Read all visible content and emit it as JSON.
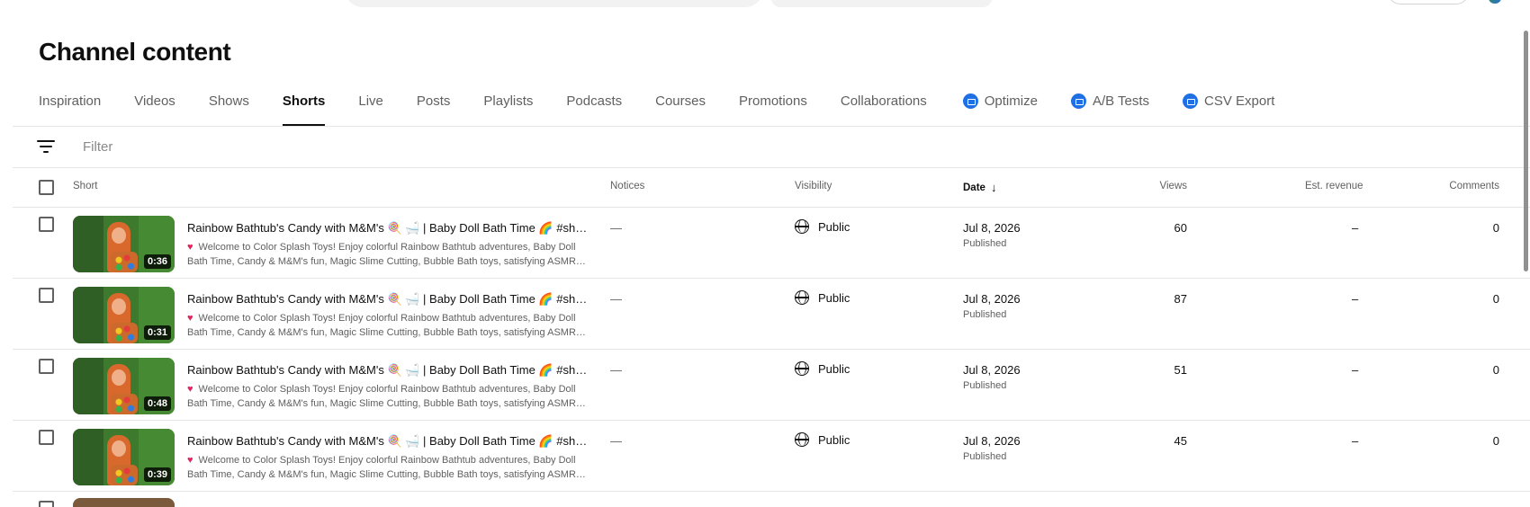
{
  "page": {
    "title": "Channel content"
  },
  "tabs": [
    {
      "label": "Inspiration",
      "active": false,
      "ext": false
    },
    {
      "label": "Videos",
      "active": false,
      "ext": false
    },
    {
      "label": "Shows",
      "active": false,
      "ext": false
    },
    {
      "label": "Shorts",
      "active": true,
      "ext": false
    },
    {
      "label": "Live",
      "active": false,
      "ext": false
    },
    {
      "label": "Posts",
      "active": false,
      "ext": false
    },
    {
      "label": "Playlists",
      "active": false,
      "ext": false
    },
    {
      "label": "Podcasts",
      "active": false,
      "ext": false
    },
    {
      "label": "Courses",
      "active": false,
      "ext": false
    },
    {
      "label": "Promotions",
      "active": false,
      "ext": false
    },
    {
      "label": "Collaborations",
      "active": false,
      "ext": false
    },
    {
      "label": "Optimize",
      "active": false,
      "ext": true
    },
    {
      "label": "A/B Tests",
      "active": false,
      "ext": true
    },
    {
      "label": "CSV Export",
      "active": false,
      "ext": true
    }
  ],
  "filter": {
    "placeholder": "Filter",
    "icon": "filter-icon"
  },
  "table": {
    "headers": {
      "short": "Short",
      "notices": "Notices",
      "visibility": "Visibility",
      "date": "Date",
      "views": "Views",
      "revenue": "Est. revenue",
      "comments": "Comments"
    },
    "rows": [
      {
        "duration": "0:36",
        "title": "Rainbow Bathtub's Candy with M&M's 🍭 🛁 | Baby Doll Bath Time 🌈 #shorts",
        "description": "Welcome to Color Splash Toys! Enjoy colorful Rainbow Bathtub adventures, Baby Doll Bath Time, Candy & M&M's fun, Magic Slime Cutting, Bubble Bath toys, satisfying ASMR…",
        "notice": "—",
        "visibility": "Public",
        "date": "Jul 8, 2026",
        "status": "Published",
        "views": "60",
        "revenue": "–",
        "comments": "0"
      },
      {
        "duration": "0:31",
        "title": "Rainbow Bathtub's Candy with M&M's 🍭 🛁 | Baby Doll Bath Time 🌈 #shorts",
        "description": "Welcome to Color Splash Toys! Enjoy colorful Rainbow Bathtub adventures, Baby Doll Bath Time, Candy & M&M's fun, Magic Slime Cutting, Bubble Bath toys, satisfying ASMR…",
        "notice": "—",
        "visibility": "Public",
        "date": "Jul 8, 2026",
        "status": "Published",
        "views": "87",
        "revenue": "–",
        "comments": "0"
      },
      {
        "duration": "0:48",
        "title": "Rainbow Bathtub's Candy with M&M's 🍭 🛁 | Baby Doll Bath Time 🌈 #shorts",
        "description": "Welcome to Color Splash Toys! Enjoy colorful Rainbow Bathtub adventures, Baby Doll Bath Time, Candy & M&M's fun, Magic Slime Cutting, Bubble Bath toys, satisfying ASMR…",
        "notice": "—",
        "visibility": "Public",
        "date": "Jul 8, 2026",
        "status": "Published",
        "views": "51",
        "revenue": "–",
        "comments": "0"
      },
      {
        "duration": "0:39",
        "title": "Rainbow Bathtub's Candy with M&M's 🍭 🛁 | Baby Doll Bath Time 🌈 #shorts",
        "description": "Welcome to Color Splash Toys! Enjoy colorful Rainbow Bathtub adventures, Baby Doll Bath Time, Candy & M&M's fun, Magic Slime Cutting, Bubble Bath toys, satisfying ASMR…",
        "notice": "—",
        "visibility": "Public",
        "date": "Jul 8, 2026",
        "status": "Published",
        "views": "45",
        "revenue": "–",
        "comments": "0"
      }
    ]
  },
  "colors": {
    "accent": "#0f0f0f",
    "ext_badge": "#1f6fe5",
    "heart": "#e0245e"
  }
}
